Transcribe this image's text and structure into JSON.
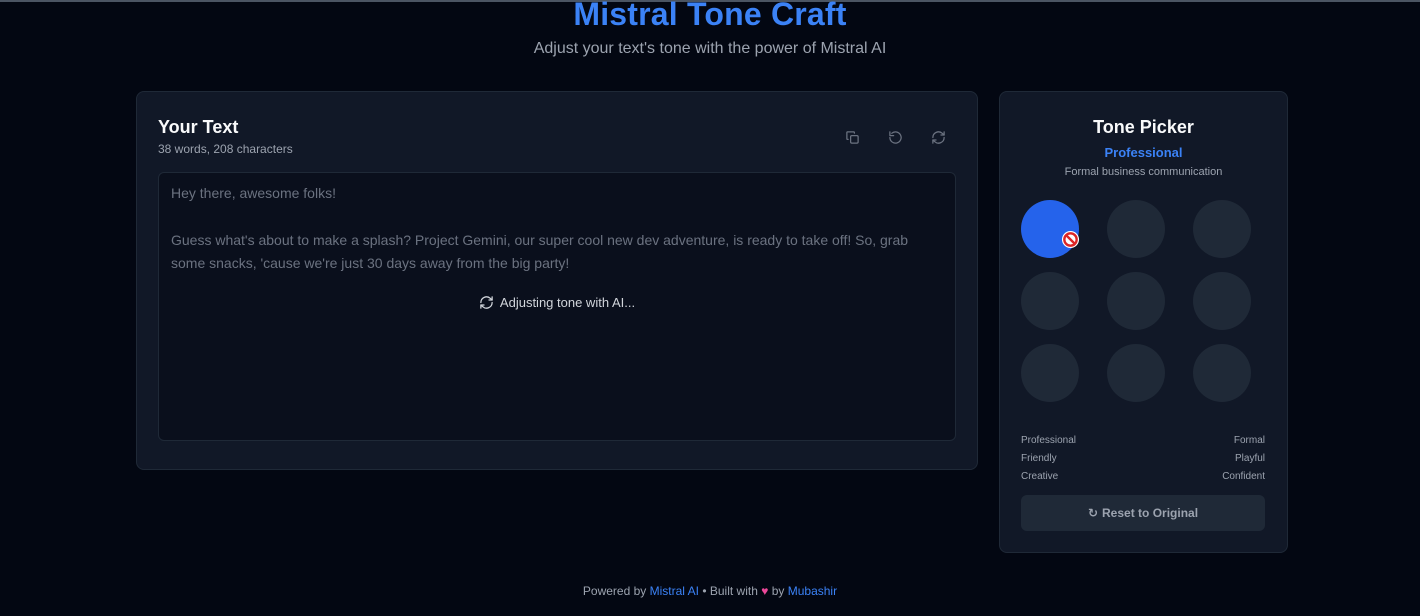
{
  "header": {
    "title": "Mistral Tone Craft",
    "subtitle": "Adjust your text's tone with the power of Mistral AI"
  },
  "editor": {
    "title": "Your Text",
    "stats": "38 words, 208 characters",
    "paragraphs": [
      "Hey there, awesome folks!",
      "Guess what's about to make a splash? Project Gemini, our super cool new dev adventure, is ready to take off! So, grab",
      "some snacks, 'cause we're just 30 days away from the big party!"
    ],
    "loading_text": "Adjusting tone with AI...",
    "toolbar_icons": [
      "copy-icon",
      "undo-icon",
      "refresh-icon"
    ]
  },
  "tone_picker": {
    "title": "Tone Picker",
    "selected_tone": "Professional",
    "selected_description": "Formal business communication",
    "labels": {
      "left": [
        "Professional",
        "Friendly",
        "Creative"
      ],
      "right": [
        "Formal",
        "Playful",
        "Confident"
      ]
    },
    "reset_icon": "↻",
    "reset_label": "Reset to Original",
    "colors": {
      "active": "#2563eb",
      "inactive": "#1f2937",
      "accent": "#3b82f6"
    }
  },
  "footer": {
    "powered_by": "Powered by",
    "mistral_link": "Mistral AI",
    "built_with": "• Built with",
    "heart": "♥",
    "by": "by",
    "author_link": "Mubashir"
  }
}
